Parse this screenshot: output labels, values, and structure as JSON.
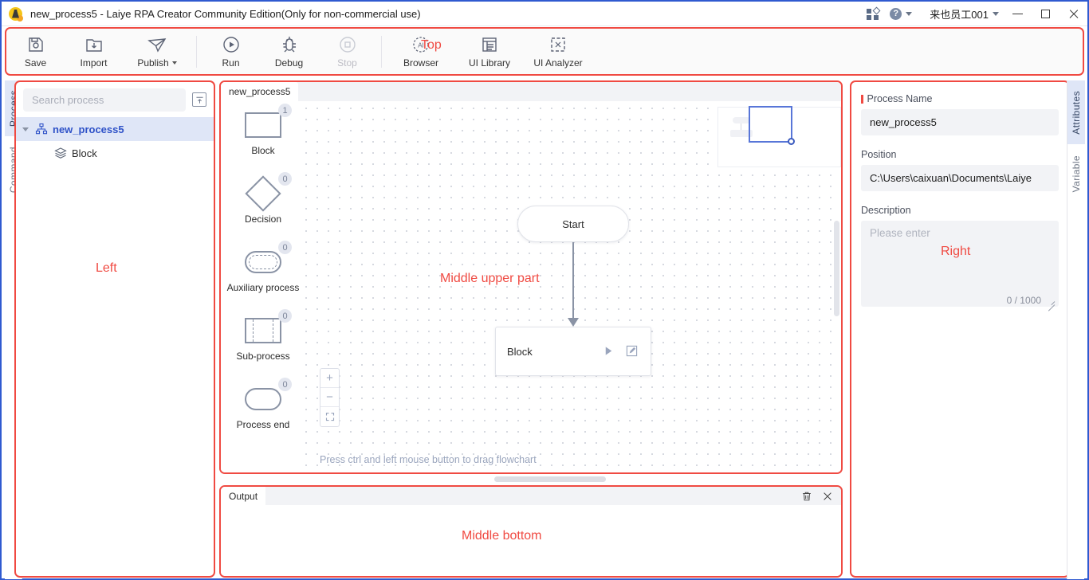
{
  "window": {
    "title": "new_process5 - Laiye RPA Creator Community Edition(Only for non-commercial use)",
    "app_icon": "laiye-app-icon",
    "apps_icon": "apps-grid-icon",
    "help_icon": "help-circle-icon",
    "help_glyph": "?",
    "user": "来也员工001",
    "minimize": "minimize-icon",
    "maximize": "maximize-icon",
    "close": "close-icon"
  },
  "toolbar": {
    "overlay_label": "Top",
    "buttons": [
      {
        "label": "Save",
        "icon": "save-disk-icon",
        "disabled": false
      },
      {
        "label": "Import",
        "icon": "import-folder-icon",
        "disabled": false
      },
      {
        "label": "Publish",
        "icon": "publish-paperplane-icon",
        "disabled": false,
        "has_dropdown": true
      },
      {
        "label": "Run",
        "icon": "run-play-circle-icon",
        "disabled": false
      },
      {
        "label": "Debug",
        "icon": "debug-bug-icon",
        "disabled": false
      },
      {
        "label": "Stop",
        "icon": "stop-square-circle-icon",
        "disabled": true
      },
      {
        "label": "Browser",
        "icon": "browser-ai-circle-icon",
        "disabled": false
      },
      {
        "label": "UI Library",
        "icon": "ui-library-icon",
        "disabled": false
      },
      {
        "label": "UI Analyzer",
        "icon": "ui-analyzer-crop-icon",
        "disabled": false
      }
    ]
  },
  "left": {
    "overlay_label": "Left",
    "tabs": [
      {
        "label": "Process",
        "active": true
      },
      {
        "label": "Command",
        "active": false
      }
    ],
    "search": {
      "placeholder": "Search process",
      "value": "",
      "collapse_icon": "collapse-all-icon"
    },
    "tree": [
      {
        "label": "new_process5",
        "icon": "sitemap-icon",
        "level": 0,
        "selected": true,
        "expanded": true
      },
      {
        "label": "Block",
        "icon": "layers-stack-icon",
        "level": 1,
        "selected": false
      }
    ]
  },
  "center": {
    "overlay_label": "Middle upper part",
    "tab_label": "new_process5",
    "palette": [
      {
        "label": "Block",
        "count": "1",
        "shape": "rectangle"
      },
      {
        "label": "Decision",
        "count": "0",
        "shape": "diamond"
      },
      {
        "label": "Auxiliary process",
        "count": "0",
        "shape": "rounded-dashed"
      },
      {
        "label": "Sub-process",
        "count": "0",
        "shape": "rectangle-dashed-sides"
      },
      {
        "label": "Process end",
        "count": "0",
        "shape": "rounded"
      }
    ],
    "nodes": [
      {
        "label": "Start",
        "type": "start"
      },
      {
        "label": "Block",
        "type": "block",
        "run_icon": "play-icon",
        "edit_icon": "edit-pencil-icon"
      }
    ],
    "zoom_controls": [
      {
        "icon": "zoom-in-icon",
        "glyph": "+"
      },
      {
        "icon": "zoom-out-icon",
        "glyph": "−"
      },
      {
        "icon": "fit-screen-icon",
        "glyph": "⛶"
      }
    ],
    "hint": "Press ctrl and left mouse button to drag flowchart",
    "minimap": "minimap-viewport"
  },
  "output": {
    "overlay_label": "Middle bottom",
    "tab_label": "Output",
    "clear_icon": "trash-icon",
    "close_icon": "close-icon",
    "content": ""
  },
  "right": {
    "overlay_label": "Right",
    "tabs": [
      {
        "label": "Attributes",
        "active": true
      },
      {
        "label": "Variable",
        "active": false
      }
    ],
    "fields": {
      "process_name": {
        "label": "Process Name",
        "value": "new_process5",
        "required": true
      },
      "position": {
        "label": "Position",
        "value": "C:\\Users\\caixuan\\Documents\\Laiye"
      },
      "description": {
        "label": "Description",
        "value": "",
        "placeholder": "Please enter",
        "counter": "0 / 1000"
      }
    }
  },
  "colors": {
    "accent_red": "#f04a42",
    "brand_blue": "#2f52c8",
    "selection_blue": "#dfe6f7",
    "window_border": "#2f5ad0",
    "shape_gray": "#8a93a5"
  }
}
